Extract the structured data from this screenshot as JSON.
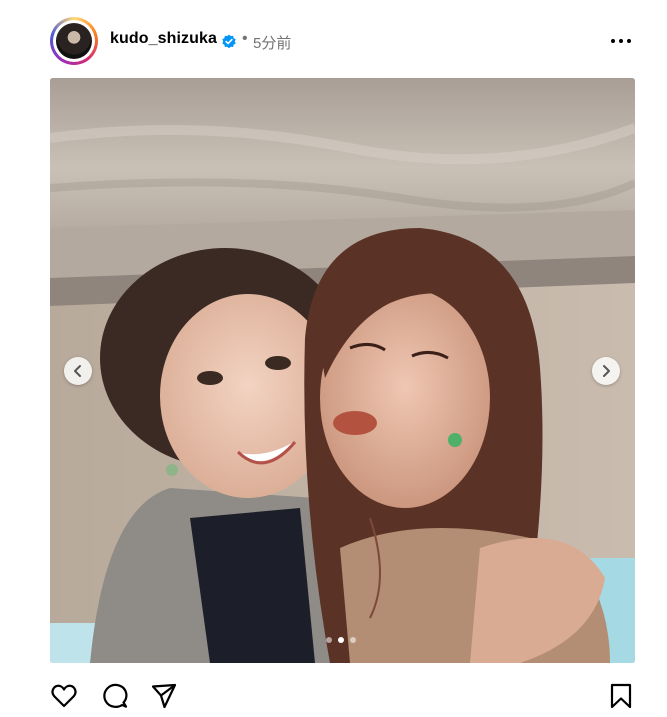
{
  "post": {
    "username": "kudo_shizuka",
    "separator": "•",
    "time_ago": "5分前"
  },
  "icons": {
    "verified": "verified-badge-icon",
    "more": "more-options-icon",
    "like": "heart-icon",
    "comment": "comment-icon",
    "share": "send-icon",
    "save": "bookmark-icon",
    "prev": "chevron-left-icon",
    "next": "chevron-right-icon"
  },
  "carousel": {
    "slide_count": 3,
    "active_index": 1
  },
  "colors": {
    "verified": "#0095f6",
    "muted_text": "#737373",
    "icon": "#000000"
  }
}
